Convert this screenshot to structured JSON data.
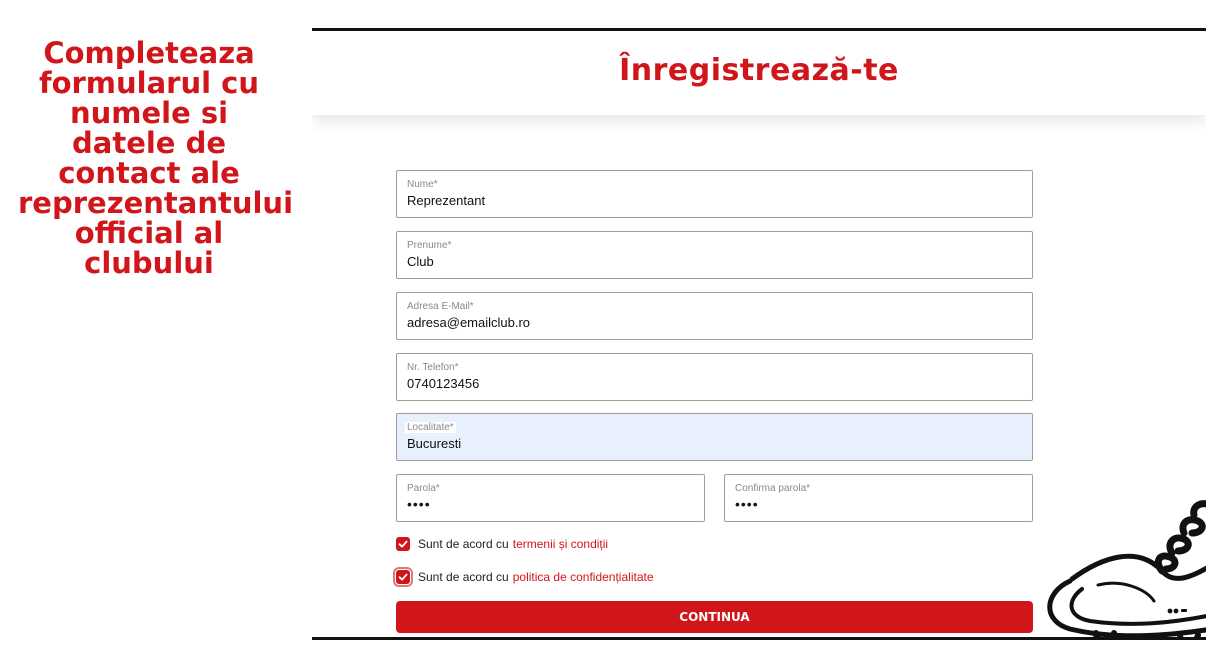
{
  "caption": "Completeaza formularul cu numele si datele de contact ale reprezentantului official al clubului",
  "form": {
    "title": "Înregistrează-te",
    "fields": {
      "nume": {
        "label": "Nume*",
        "value": "Reprezentant"
      },
      "prenume": {
        "label": "Prenume*",
        "value": "Club"
      },
      "email": {
        "label": "Adresa E-Mail*",
        "value": "adresa@emailclub.ro"
      },
      "telefon": {
        "label": "Nr. Telefon*",
        "value": "0740123456"
      },
      "localitate": {
        "label": "Localitate*",
        "value": "Bucuresti"
      },
      "parola": {
        "label": "Parola*",
        "value": "••••"
      },
      "confirma": {
        "label": "Confirma parola*",
        "value": "••••"
      }
    },
    "terms": {
      "text": "Sunt de acord cu",
      "link": "termenii și condiții",
      "checked": true
    },
    "privacy": {
      "text": "Sunt de acord cu",
      "link": "politica de confidențialitate",
      "checked": true
    },
    "submit_label": "CONTINUA"
  },
  "colors": {
    "accent": "#d0161b",
    "autofill": "#e8f0fe",
    "border": "#9e9e9e"
  },
  "icons": {
    "checkbox": "check-icon",
    "decoration": "football-boot-icon"
  }
}
